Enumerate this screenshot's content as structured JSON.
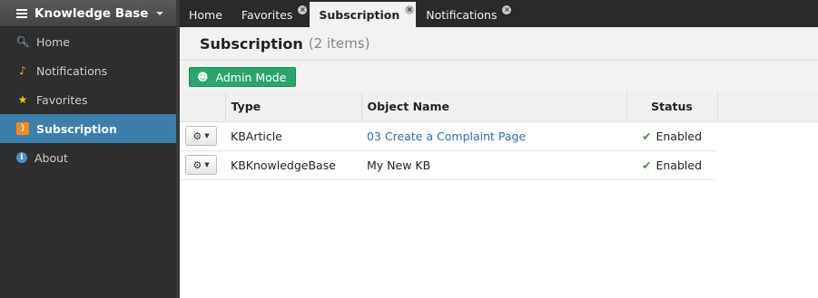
{
  "sidebar": {
    "title": "Knowledge Base",
    "items": [
      {
        "label": "Home",
        "icon": "search-icon"
      },
      {
        "label": "Notifications",
        "icon": "bell-icon"
      },
      {
        "label": "Favorites",
        "icon": "star-icon"
      },
      {
        "label": "Subscription",
        "icon": "rss-icon",
        "active": true
      },
      {
        "label": "About",
        "icon": "info-icon"
      }
    ]
  },
  "tabs": [
    {
      "label": "Home"
    },
    {
      "label": "Favorites",
      "closable": true
    },
    {
      "label": "Subscription",
      "closable": true,
      "active": true
    },
    {
      "label": "Notifications",
      "closable": true
    }
  ],
  "page": {
    "title": "Subscription",
    "count": "(2 items)"
  },
  "toolbar": {
    "admin_label": "Admin Mode"
  },
  "table": {
    "columns": [
      "Type",
      "Object Name",
      "Status"
    ],
    "rows": [
      {
        "type": "KBArticle",
        "name": "03 Create a Complaint Page",
        "status": "Enabled"
      },
      {
        "type": "KBKnowledgeBase",
        "name": "My New KB",
        "status": "Enabled"
      }
    ]
  },
  "colors": {
    "accent": "#3c7eac",
    "button_green": "#2aa66d",
    "link": "#2a6db5",
    "status_green": "#3c8a2a"
  }
}
